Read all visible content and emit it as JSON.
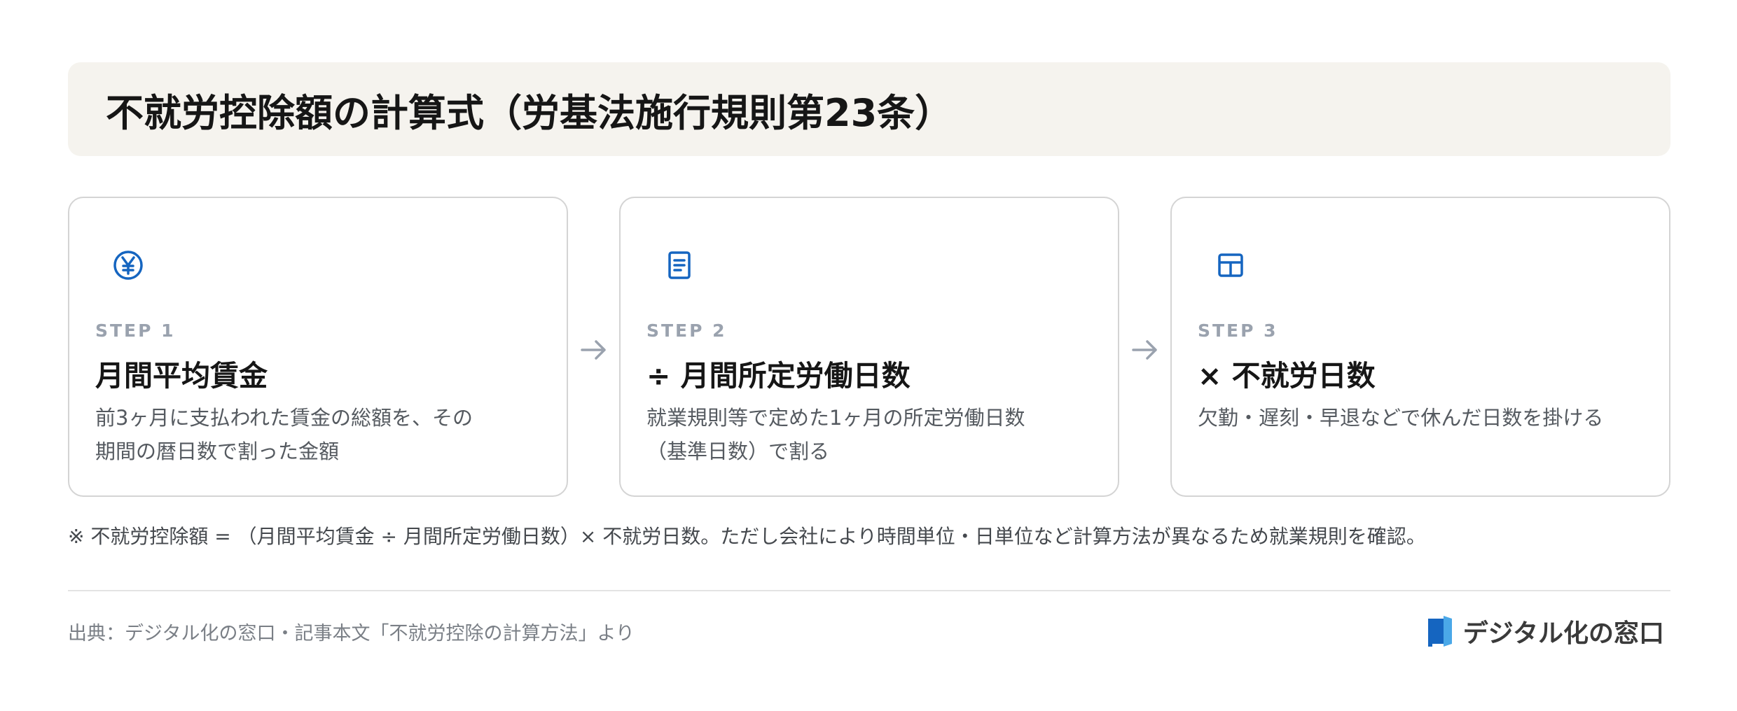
{
  "title": "不就労控除額の計算式（労基法施行規則第23条）",
  "colors": {
    "accent": "#1565c0",
    "title_bg": "#f5f3ee",
    "step_label": "#9aa2ae",
    "arrow": "#9aa2ae"
  },
  "steps": [
    {
      "icon": "yen-circle-icon",
      "label": "STEP 1",
      "heading": "月間平均賃金",
      "desc": [
        "前3ヶ月に支払われた賃金の総額を、その",
        "期間の暦日数で割った金額"
      ]
    },
    {
      "icon": "document-icon",
      "label": "STEP 2",
      "heading": "÷ 月間所定労働日数",
      "desc": [
        "就業規則等で定めた1ヶ月の所定労働日数",
        "（基準日数）で割る"
      ]
    },
    {
      "icon": "table-icon",
      "label": "STEP 3",
      "heading": "× 不就労日数",
      "desc": [
        "欠勤・遅刻・早退などで休んだ日数を掛ける",
        ""
      ]
    }
  ],
  "note": "※ 不就労控除額 = （月間平均賃金 ÷ 月間所定労働日数）× 不就労日数。ただし会社により時間単位・日単位など計算方法が異なるため就業規則を確認。",
  "source": "出典：デジタル化の窓口・記事本文「不就労控除の計算方法」より",
  "brand": {
    "name": "デジタル化の窓口",
    "icon": "brand-logo-icon"
  }
}
